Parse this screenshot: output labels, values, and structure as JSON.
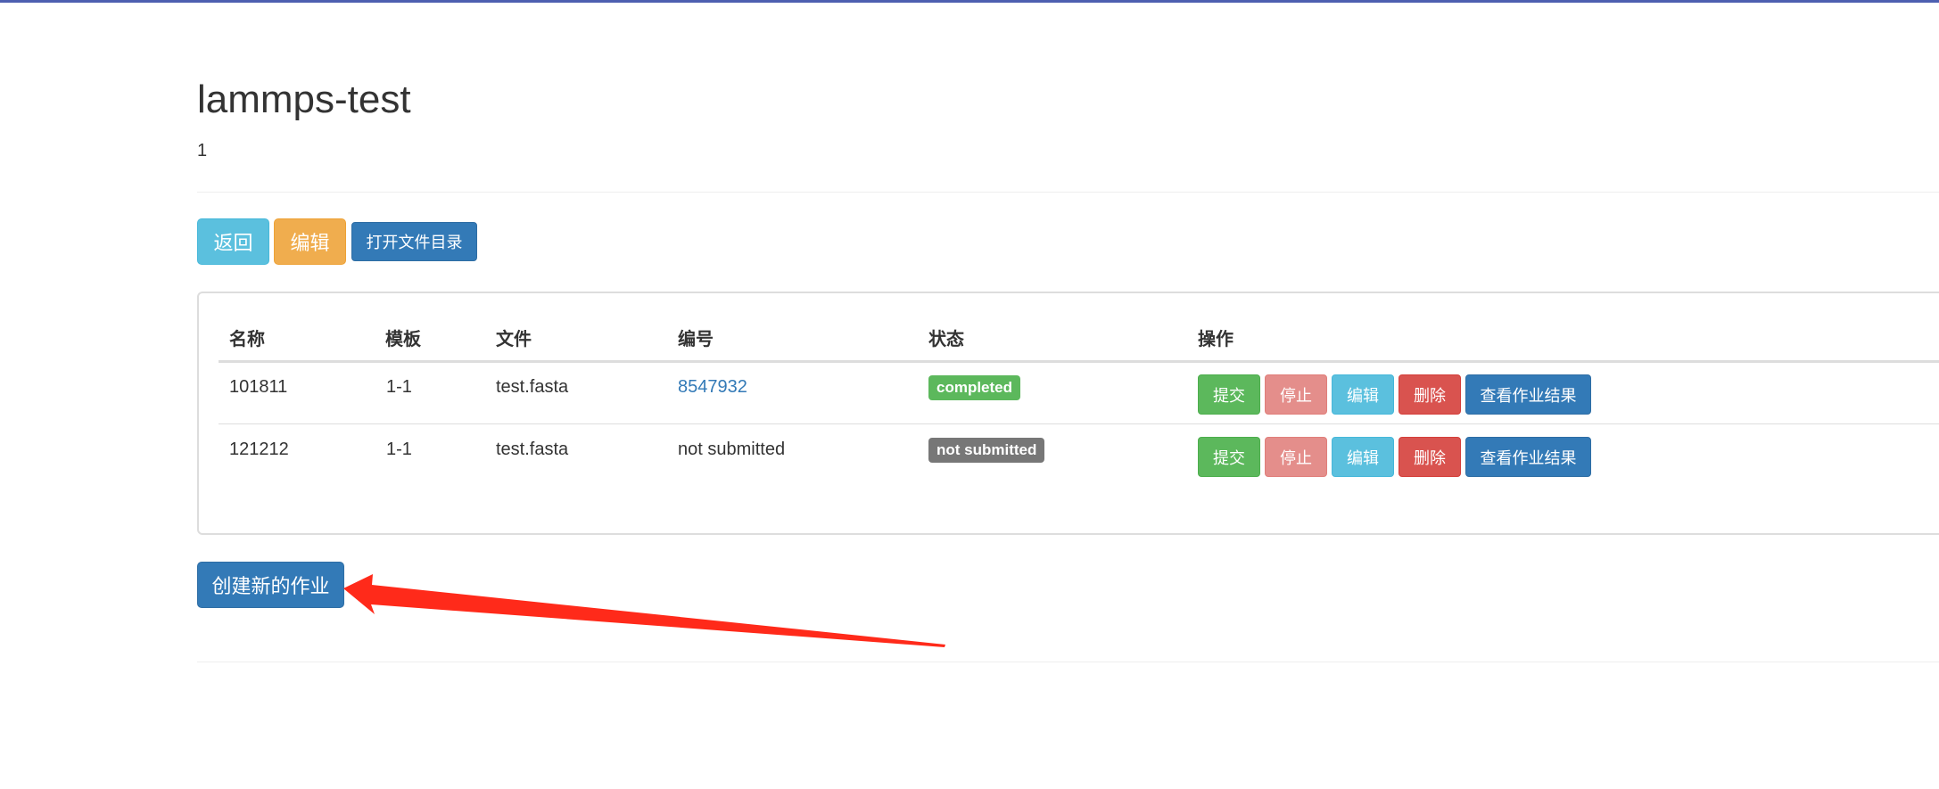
{
  "page": {
    "title": "lammps-test",
    "subtitle": "1"
  },
  "actions": {
    "back": "返回",
    "edit": "编辑",
    "open_dir": "打开文件目录"
  },
  "table": {
    "headers": {
      "name": "名称",
      "template": "模板",
      "file": "文件",
      "id": "编号",
      "status": "状态",
      "operations": "操作"
    },
    "rows": [
      {
        "name": "101811",
        "template": "1-1",
        "file": "test.fasta",
        "id": "8547932",
        "status": "completed",
        "status_color": "#5cb85c",
        "buttons": {
          "submit": "提交",
          "stop": "停止",
          "edit": "编辑",
          "delete": "删除",
          "view": "查看作业结果"
        }
      },
      {
        "name": "121212",
        "template": "1-1",
        "file": "test.fasta",
        "id": "not submitted",
        "status": "not submitted",
        "status_color": "#777777",
        "buttons": {
          "submit": "提交",
          "stop": "停止",
          "edit": "编辑",
          "delete": "删除",
          "view": "查看作业结果"
        }
      }
    ]
  },
  "create_job": "创建新的作业",
  "annotation": {
    "arrow_color": "#ff2a1a"
  }
}
